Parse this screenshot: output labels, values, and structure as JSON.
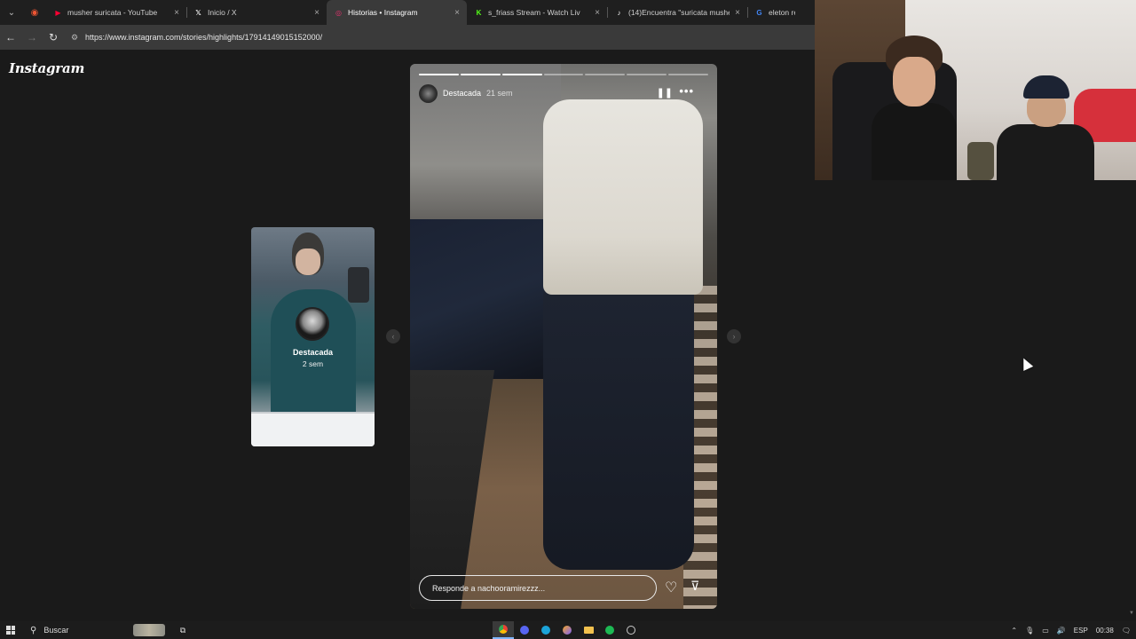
{
  "browser": {
    "tabs": [
      {
        "title": "musher suricata - YouTube",
        "icon": "youtube-icon",
        "color": "#ff0033",
        "glyph": "▶",
        "active": false
      },
      {
        "title": "Inicio / X",
        "icon": "x-icon",
        "color": "#ffffff",
        "glyph": "𝕏",
        "active": false
      },
      {
        "title": "Historias • Instagram",
        "icon": "instagram-icon",
        "color": "#e1306c",
        "glyph": "◎",
        "active": true
      },
      {
        "title": "s_friass Stream - Watch Liv",
        "icon": "kick-icon",
        "color": "#53fc18",
        "glyph": "K",
        "active": false
      },
      {
        "title": "(14)Encuentra \"suricata musher",
        "icon": "tiktok-icon",
        "color": "#ffffff",
        "glyph": "♪",
        "active": false
      },
      {
        "title": "eleton resort",
        "icon": "google-icon",
        "color": "#4285f4",
        "glyph": "G",
        "active": false
      }
    ],
    "url": "https://www.instagram.com/stories/highlights/17914149015152000/"
  },
  "instagram": {
    "logo": "Instagram",
    "side_story": {
      "name": "Destacada",
      "time": "2 sem"
    },
    "story": {
      "name": "Destacada",
      "time": "21 sem",
      "progress_segments": 7,
      "progress_done": 3,
      "reply_placeholder": "Responde a nachooramirezzz..."
    }
  },
  "taskbar": {
    "search_label": "Buscar",
    "language": "ESP",
    "time": "00:38"
  }
}
